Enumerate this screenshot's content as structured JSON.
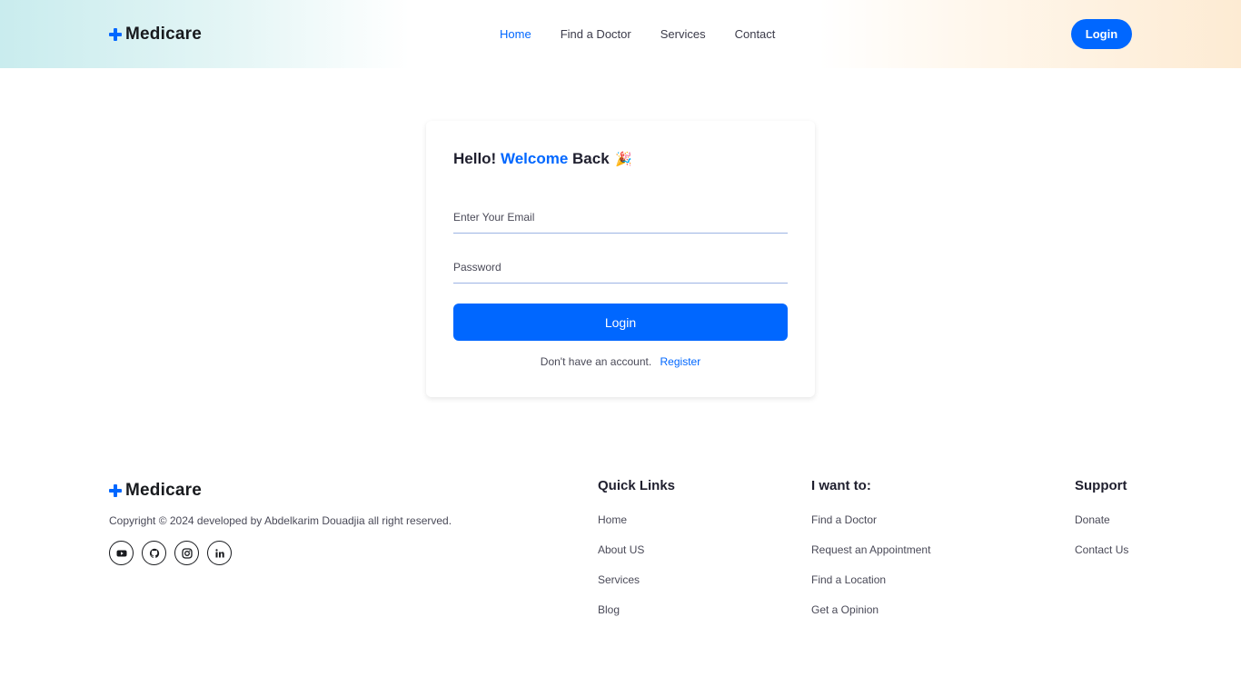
{
  "brand": {
    "name": "Medicare",
    "icon": "plus-icon",
    "accent_color": "#0067ff"
  },
  "header": {
    "nav": [
      {
        "label": "Home",
        "active": true
      },
      {
        "label": "Find a Doctor",
        "active": false
      },
      {
        "label": "Services",
        "active": false
      },
      {
        "label": "Contact",
        "active": false
      }
    ],
    "login_label": "Login"
  },
  "login_card": {
    "title_start": "Hello!",
    "title_accent": "Welcome",
    "title_end": "Back",
    "title_emoji": "🎉",
    "email_placeholder": "Enter Your Email",
    "password_placeholder": "Password",
    "submit_label": "Login",
    "register_prompt": "Don't have an account.",
    "register_link": "Register"
  },
  "footer": {
    "copyright": "Copyright © 2024 developed by Abdelkarim Douadjia all right reserved.",
    "socials": [
      "youtube-icon",
      "github-icon",
      "instagram-icon",
      "linkedin-icon"
    ],
    "quick_links": {
      "title": "Quick Links",
      "items": [
        "Home",
        "About US",
        "Services",
        "Blog"
      ]
    },
    "i_want_to": {
      "title": "I want to:",
      "items": [
        "Find a Doctor",
        "Request an Appointment",
        "Find a Location",
        "Get a Opinion"
      ]
    },
    "support": {
      "title": "Support",
      "items": [
        "Donate",
        "Contact Us"
      ]
    }
  }
}
